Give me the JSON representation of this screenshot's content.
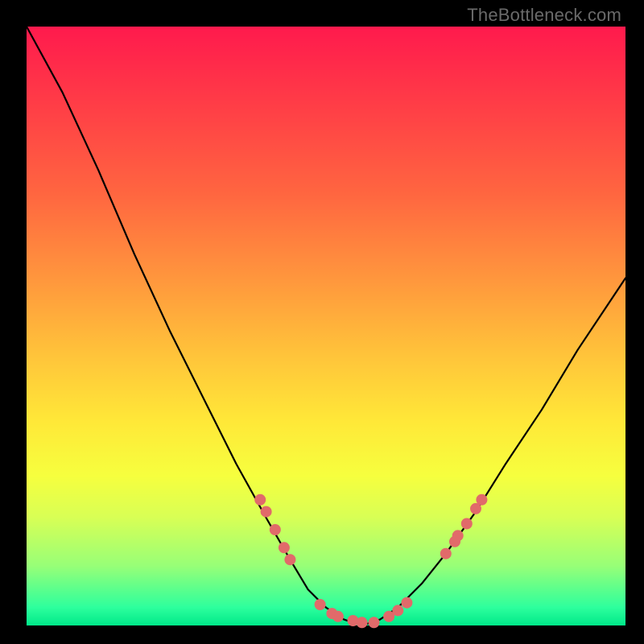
{
  "watermark": "TheBottleneck.com",
  "colors": {
    "frame": "#000000",
    "curve": "#000000",
    "dots": "#e16a6a",
    "gradient_stops": [
      "#ff1a4d",
      "#ff963d",
      "#ffe838",
      "#2dff9d"
    ]
  },
  "chart_data": {
    "type": "line",
    "title": "",
    "xlabel": "",
    "ylabel": "",
    "xlim": [
      0,
      100
    ],
    "ylim": [
      0,
      100
    ],
    "series": [
      {
        "name": "bottleneck-curve",
        "x": [
          0,
          6,
          12,
          18,
          24,
          30,
          35,
          40,
          44,
          47,
          50,
          53,
          56,
          59,
          62,
          66,
          70,
          75,
          80,
          86,
          92,
          100
        ],
        "y": [
          100,
          89,
          76,
          62,
          49,
          37,
          27,
          18,
          11,
          6,
          3,
          1,
          0,
          1,
          3,
          7,
          12,
          19,
          27,
          36,
          46,
          58
        ]
      }
    ],
    "annotations": {
      "left_cluster_dots": [
        {
          "x": 39,
          "y": 21
        },
        {
          "x": 40,
          "y": 19
        },
        {
          "x": 41.5,
          "y": 16
        },
        {
          "x": 43,
          "y": 13
        },
        {
          "x": 44,
          "y": 11
        }
      ],
      "bottom_dots": [
        {
          "x": 49,
          "y": 3.5
        },
        {
          "x": 51,
          "y": 2
        },
        {
          "x": 52,
          "y": 1.5
        },
        {
          "x": 54.5,
          "y": 0.8
        },
        {
          "x": 56,
          "y": 0.5
        },
        {
          "x": 58,
          "y": 0.5
        },
        {
          "x": 60.5,
          "y": 1.5
        },
        {
          "x": 62,
          "y": 2.5
        },
        {
          "x": 63.5,
          "y": 3.8
        }
      ],
      "right_cluster_dots": [
        {
          "x": 70,
          "y": 12
        },
        {
          "x": 71.5,
          "y": 14
        },
        {
          "x": 72,
          "y": 15
        },
        {
          "x": 73.5,
          "y": 17
        },
        {
          "x": 75,
          "y": 19.5
        },
        {
          "x": 76,
          "y": 21
        }
      ]
    }
  }
}
